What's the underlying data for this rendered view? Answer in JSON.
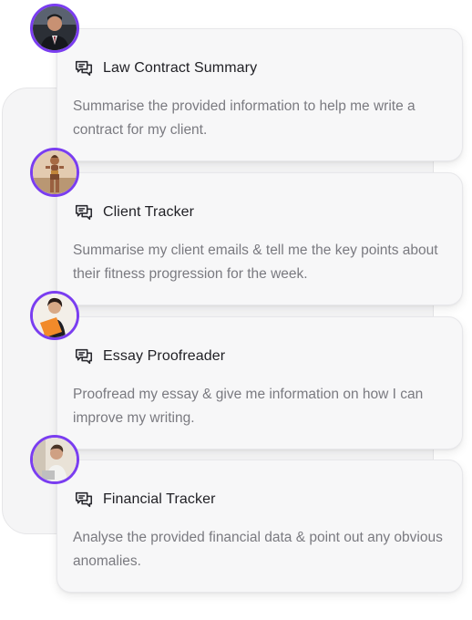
{
  "cards": [
    {
      "title": "Law Contract Summary",
      "description": "Summarise the provided information to help me write a contract for my client.",
      "avatar": "man-in-suit-avatar"
    },
    {
      "title": "Client Tracker",
      "description": "Summarise my client emails & tell me the key points about their fitness progression for the week.",
      "avatar": "fitness-woman-avatar"
    },
    {
      "title": "Essay Proofreader",
      "description": "Proofread my essay & give me information on how I can improve my writing.",
      "avatar": "woman-with-folder-avatar"
    },
    {
      "title": "Financial Tracker",
      "description": "Analyse the provided financial data & point out any obvious anomalies.",
      "avatar": "man-at-laptop-avatar"
    }
  ],
  "icon": "chat-bubble-icon",
  "colors": {
    "avatar_ring": "#7a3df0",
    "card_bg": "#f7f7f8",
    "title": "#1f1f24",
    "description": "#7a7a80"
  }
}
